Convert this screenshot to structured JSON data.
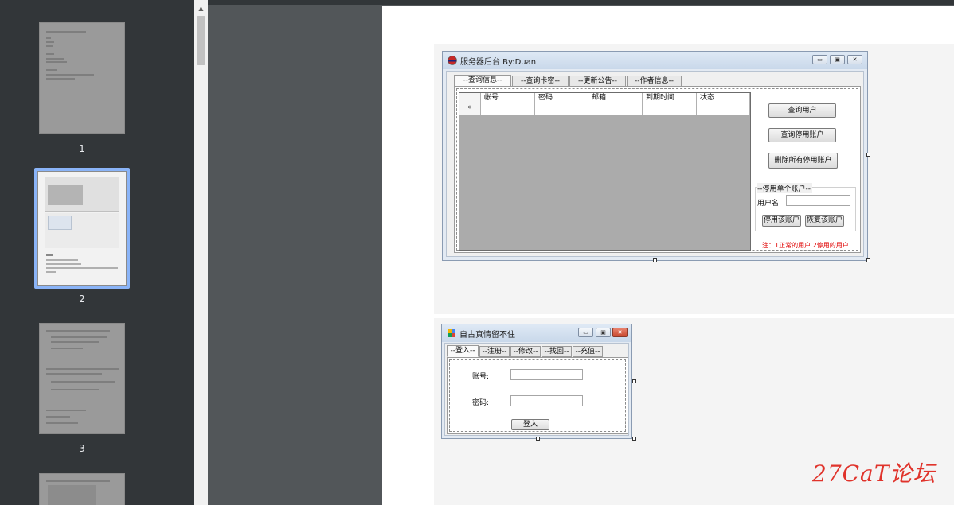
{
  "sidebar": {
    "pages": [
      {
        "number": "1",
        "selected": false
      },
      {
        "number": "2",
        "selected": true
      },
      {
        "number": "3",
        "selected": false
      }
    ]
  },
  "window1": {
    "title": "服务器后台 By:Duan",
    "tabs": [
      "--查询信息--",
      "--查询卡密--",
      "--更新公告--",
      "--作者信息--"
    ],
    "grid_columns": [
      "帐号",
      "密码",
      "邮箱",
      "到期时间",
      "状态"
    ],
    "new_row_marker": "*",
    "buttons": {
      "query_users": "查询用户",
      "query_disabled": "查询停用账户",
      "delete_disabled": "删除所有停用账户"
    },
    "group_title": "--停用单个账户--",
    "username_label": "用户名:",
    "username_value": "",
    "disable_button": "停用该账户",
    "restore_button": "恢复该账户",
    "note": "注：1正常的用户 2停用的用户",
    "note_color": "#e00000"
  },
  "window2": {
    "title": "自古真情留不住",
    "tabs": [
      "--登入--",
      "--注册--",
      "--修改--",
      "--找回--",
      "--充值--"
    ],
    "account_label": "账号:",
    "account_value": "",
    "password_label": "密码:",
    "password_value": "",
    "login_button": "登入"
  },
  "watermark": "27CaT论坛"
}
